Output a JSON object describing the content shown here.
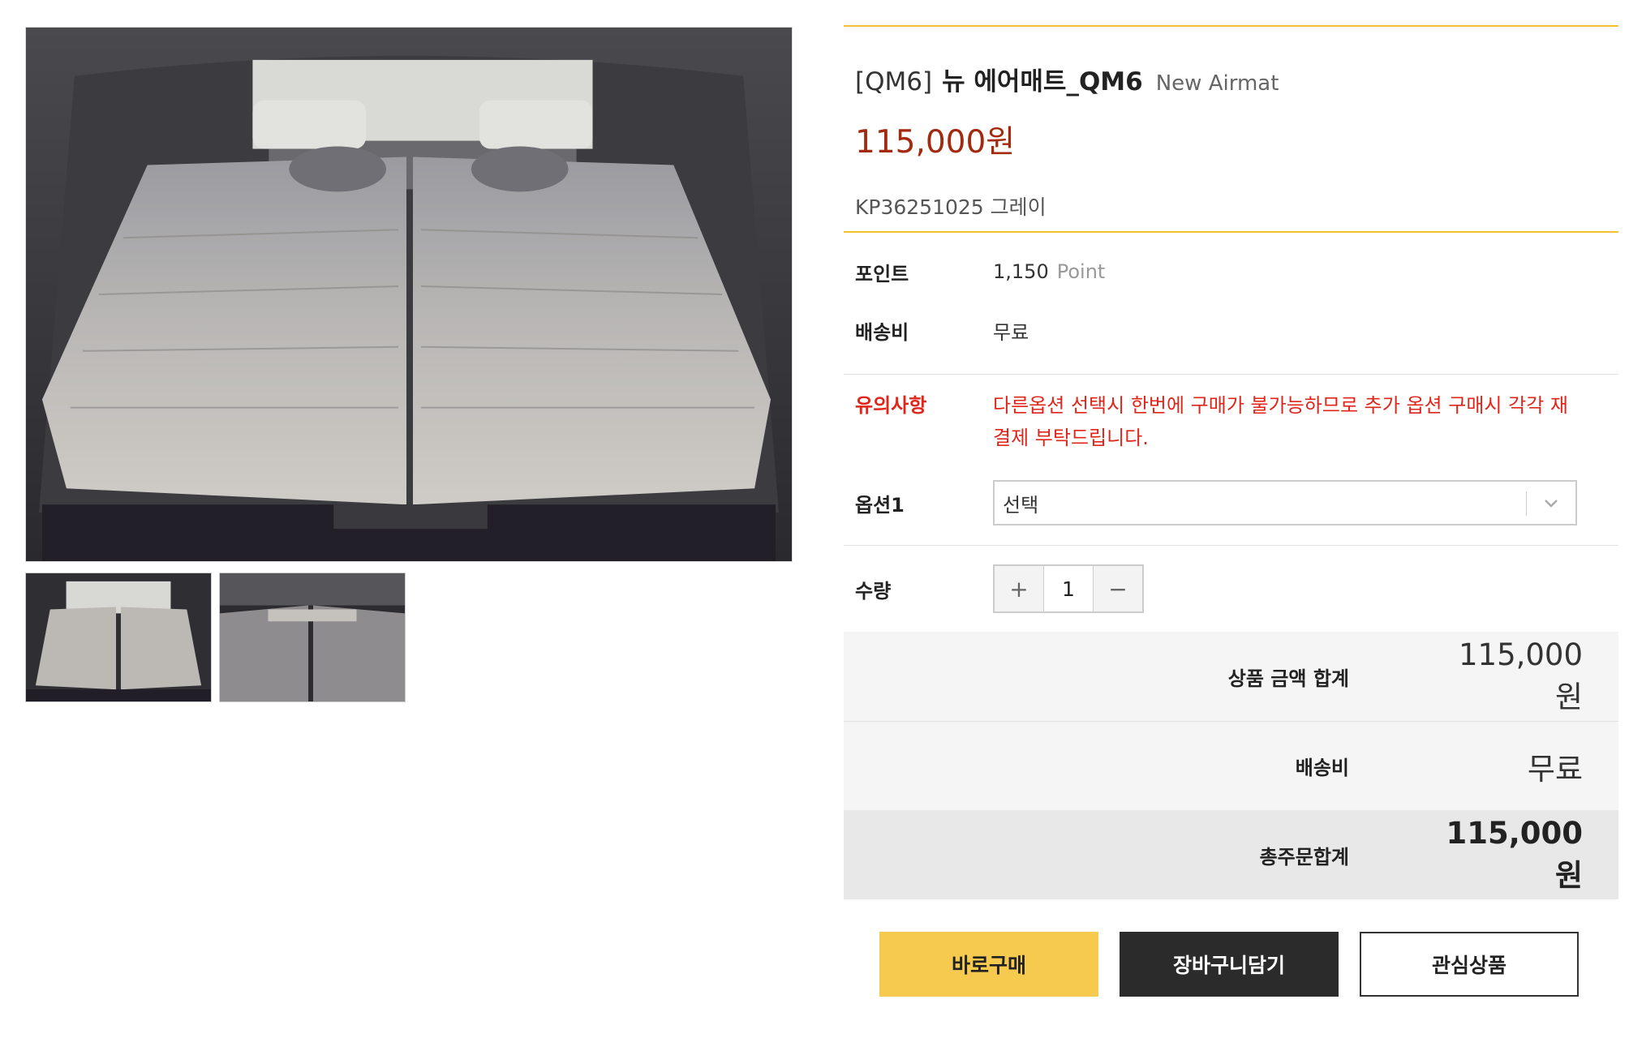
{
  "product": {
    "title_prefix": "[QM6]",
    "title_main": "뉴 에어매트_QM6",
    "title_sub": "New Airmat",
    "price": "115,000원",
    "code_line": "KP36251025 그레이"
  },
  "details": {
    "point_label": "포인트",
    "point_value": "1,150",
    "point_unit": "Point",
    "shipping_label": "배송비",
    "shipping_value": "무료",
    "notice_label": "유의사항",
    "notice_text": "다른옵션 선택시 한번에 구매가 불가능하므로 추가 옵션 구매시 각각 재결제 부탁드립니다.",
    "option_label": "옵션1",
    "option_selected": "선택",
    "quantity_label": "수량",
    "quantity_value": "1",
    "plus_symbol": "+",
    "minus_symbol": "−"
  },
  "totals": {
    "subtotal_label": "상품 금액 합계",
    "subtotal_value": "115,000원",
    "shipping_label": "배송비",
    "shipping_value": "무료",
    "grand_label": "총주문합계",
    "grand_value": "115,000원"
  },
  "actions": {
    "buy_now": "바로구매",
    "add_cart": "장바구니담기",
    "wishlist": "관심상품"
  },
  "colors": {
    "accent_yellow": "#f2c12e",
    "price_red": "#a3290f",
    "notice_red": "#e0251a",
    "buy_button": "#f5ca4f",
    "cart_button": "#2b2b2b"
  },
  "icons": {
    "select_arrow": "chevron-down-icon"
  }
}
